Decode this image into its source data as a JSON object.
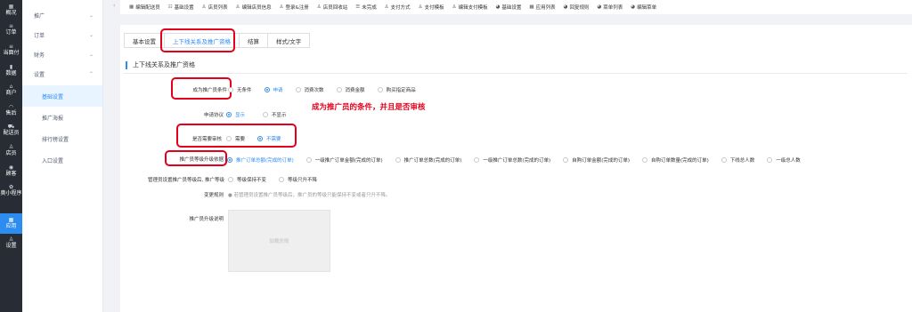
{
  "rail": [
    {
      "icon": "overview-icon",
      "glyph": "▦",
      "label": "概况"
    },
    {
      "icon": "order-icon",
      "glyph": "≡",
      "label": "订单"
    },
    {
      "icon": "store-order-icon",
      "glyph": "≡",
      "label": "当面付"
    },
    {
      "icon": "data-icon",
      "glyph": "▮",
      "label": "数据"
    },
    {
      "icon": "merchant-icon",
      "glyph": "⌂",
      "label": "商户"
    },
    {
      "icon": "after-sale-icon",
      "glyph": "◠",
      "label": "售后"
    },
    {
      "icon": "delivery-icon",
      "glyph": "⛟",
      "label": "配送员"
    },
    {
      "icon": "store-icon",
      "glyph": "♙",
      "label": "店员"
    },
    {
      "icon": "customer-icon",
      "glyph": "◉",
      "label": "顾客"
    },
    {
      "icon": "miniapp-icon",
      "glyph": "✿",
      "label": "奥小程序"
    },
    {
      "icon": "apps-icon",
      "glyph": "▦",
      "label": "应用"
    },
    {
      "icon": "settings-icon",
      "glyph": "♙",
      "label": "设置"
    }
  ],
  "sidebar": {
    "groups": [
      {
        "label": "推广",
        "chev": "⌄"
      },
      {
        "label": "订单",
        "chev": "⌄"
      },
      {
        "label": "财务",
        "chev": "⌄"
      },
      {
        "label": "设置",
        "chev": "⌃"
      }
    ],
    "items": [
      "基础设置",
      "推广海报",
      "排行榜设置",
      "入口设置"
    ]
  },
  "topbar": [
    {
      "icon": "▦",
      "label": "编辑配送员"
    },
    {
      "icon": "☷",
      "label": "基础设置"
    },
    {
      "icon": "♙",
      "label": "店员列表"
    },
    {
      "icon": "♙",
      "label": "编辑店员信息"
    },
    {
      "icon": "♙",
      "label": "登录&注册"
    },
    {
      "icon": "♙",
      "label": "店员回收站"
    },
    {
      "icon": "☰",
      "label": "未完成"
    },
    {
      "icon": "♙",
      "label": "支付方式"
    },
    {
      "icon": "♙",
      "label": "支付模板"
    },
    {
      "icon": "♙",
      "label": "编辑支付模板"
    },
    {
      "icon": "◕",
      "label": "基础设置"
    },
    {
      "icon": "▦",
      "label": "应用列表"
    },
    {
      "icon": "◕",
      "label": "回复规则"
    },
    {
      "icon": "◕",
      "label": "菜单列表"
    },
    {
      "icon": "◕",
      "label": "编辑菜单"
    }
  ],
  "tabs": [
    "基本设置",
    "上下线关系及推广资格",
    "结算",
    "样式/文字"
  ],
  "section_title": "上下线关系及推广资格",
  "fields": {
    "condition": {
      "label": "成为推广员条件",
      "options": [
        "无条件",
        "申请",
        "消费次数",
        "消费金额",
        "购买指定商品"
      ],
      "selected": 1
    },
    "agreement": {
      "label": "申请协议",
      "options": [
        "显示",
        "不显示"
      ],
      "selected": 0
    },
    "review": {
      "label": "是否需要审核",
      "options": [
        "需要",
        "不需要"
      ],
      "selected": 1
    },
    "upgrade": {
      "label": "推广员等级升级依据",
      "options": [
        "推广订单总额(完成的订单)",
        "一级推广订单金额(完成的订单)",
        "推广订单总数(完成的订单)",
        "一级推广订单总数(完成的订单)",
        "自购订单金额(完成的订单)",
        "自购订单数量(完成的订单)",
        "下线总人数",
        "一级总人数"
      ],
      "selected": 0
    },
    "after_change": {
      "label": "管理员设置推广员等级后, 推广等级",
      "options": [
        "等级保持不变",
        "等级只升不降"
      ],
      "selected": -1
    },
    "rule": {
      "label": "变更规则",
      "hint": "● 若管理员设置推广员等级后，推广员的等级只能保持不变或者只升不降。"
    },
    "desc": {
      "label": "推广员升级说明",
      "placeholder": "加载失败"
    }
  },
  "annotation": "成为推广员的条件，并且是否审核",
  "colors": {
    "accent": "#2d8cf0",
    "highlight": "#e3001b",
    "rail": "#282c35"
  }
}
